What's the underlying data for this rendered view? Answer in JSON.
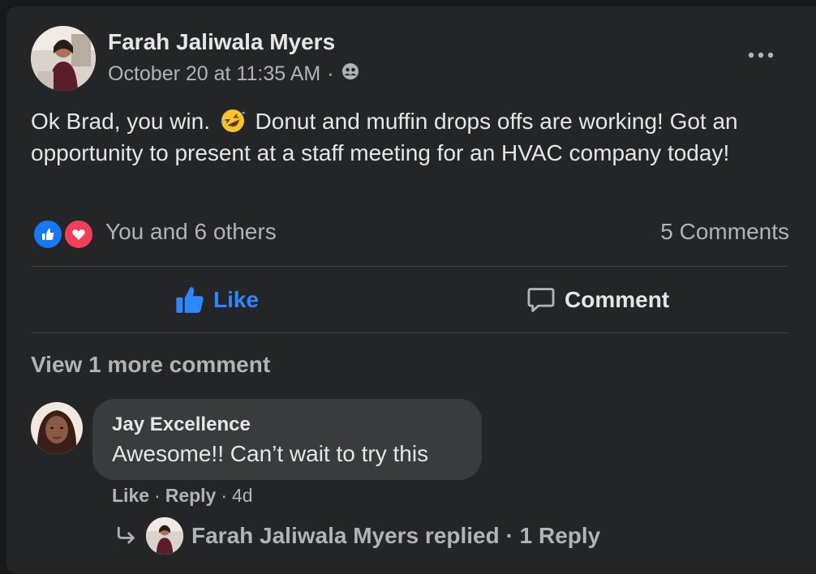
{
  "post": {
    "author": "Farah Jaliwala Myers",
    "timestamp": "October 20 at 11:35 AM",
    "separator": "·",
    "privacy_icon": "friends-icon",
    "text_before_emoji": "Ok Brad, you win.",
    "emoji": "rolling-on-floor-laughing-emoji",
    "text_after_emoji": "Donut and muffin drops offs are working! Got an opportunity to present at a staff meeting for an HVAC company today!"
  },
  "reactions": {
    "icons": [
      "like-reaction-icon",
      "love-reaction-icon"
    ],
    "summary": "You and 6 others",
    "comments_count": "5 Comments"
  },
  "actions": {
    "like_label": "Like",
    "comment_label": "Comment",
    "like_color": "#2d88ff"
  },
  "comments": {
    "view_more": "View 1 more comment",
    "items": [
      {
        "author": "Jay Excellence",
        "text": "Awesome!! Can’t wait to try this",
        "like": "Like",
        "reply": "Reply",
        "age": "4d"
      }
    ],
    "replies_summary": "Farah Jaliwala Myers replied · 1 Reply"
  },
  "colors": {
    "background": "#18191a",
    "card": "#242526",
    "bubble": "#3a3b3c",
    "text_primary": "#e4e6eb",
    "text_secondary": "#b0b3b8",
    "accent": "#2d88ff"
  }
}
